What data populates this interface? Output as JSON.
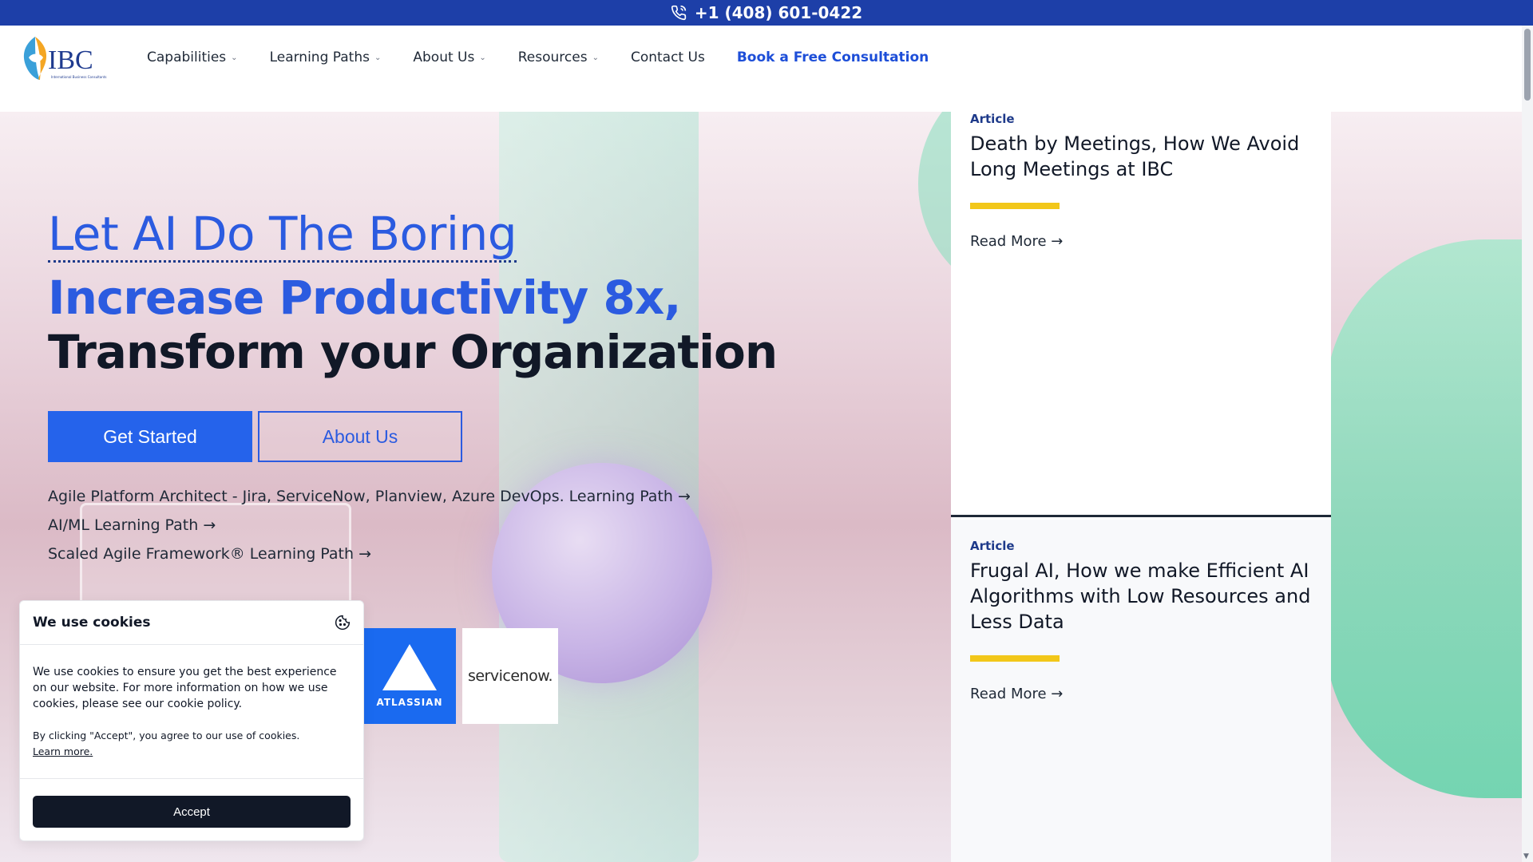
{
  "topbar": {
    "phone": "+1 (408) 601-0422"
  },
  "logo": {
    "text": "IBC",
    "subtitle": "International Business Consultants"
  },
  "nav": {
    "items": [
      {
        "label": "Capabilities"
      },
      {
        "label": "Learning Paths"
      },
      {
        "label": "About Us"
      },
      {
        "label": "Resources"
      },
      {
        "label": "Contact Us"
      }
    ],
    "cta": "Book a Free Consultation"
  },
  "hero": {
    "tagline": "Let AI Do The Boring",
    "headline1": "Increase Productivity 8x,",
    "headline2": "Transform your Organization",
    "primary_button": "Get Started",
    "secondary_button": "About Us",
    "paths": [
      "Agile Platform Architect - Jira, ServiceNow, Planview, Azure DevOps. Learning Path →",
      "AI/ML Learning Path →",
      "Scaled Agile Framework® Learning Path →"
    ],
    "partners": {
      "atlassian": "ATLASSIAN",
      "servicenow": "servicenow."
    }
  },
  "articles": [
    {
      "tag": "Article",
      "title": "Death by Meetings, How We Avoid Long Meetings at IBC",
      "link": "Read More →"
    },
    {
      "tag": "Article",
      "title": "Frugal AI, How we make Efficient AI Algorithms with Low Resources and Less Data",
      "link": "Read More →"
    }
  ],
  "cookie": {
    "title": "We use cookies",
    "text": "We use cookies to ensure you get the best experience on our website. For more information on how we use cookies, please see our cookie policy.",
    "consent": "By clicking \"Accept\", you agree to our use of cookies.",
    "learn_more": "Learn more.",
    "accept": "Accept"
  },
  "colors": {
    "topbar": "#1d3fa8",
    "accent": "#2563eb",
    "highlight": "#f2c719"
  }
}
